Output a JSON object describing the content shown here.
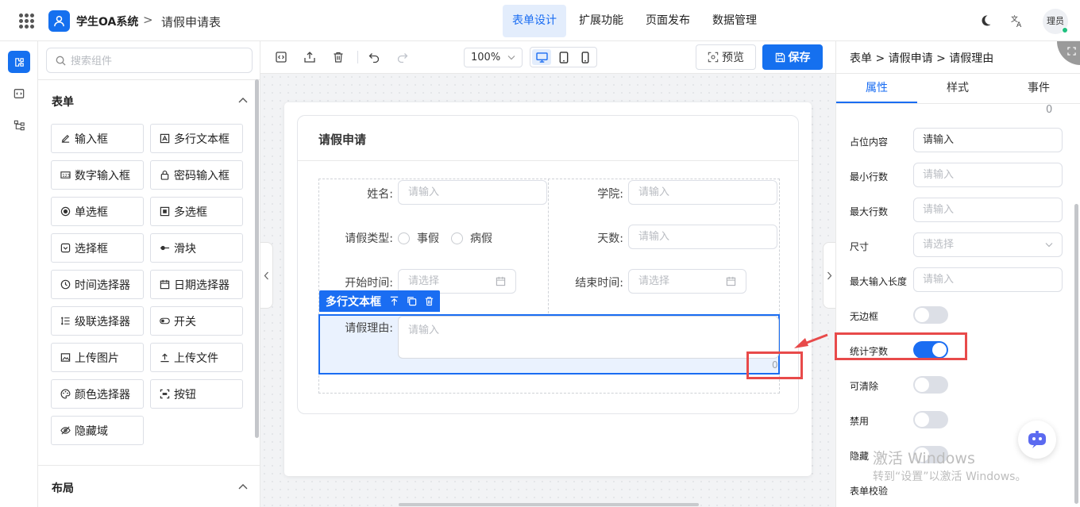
{
  "header": {
    "app_name": "学生OA系统",
    "separator": ">",
    "page_name": "请假申请表",
    "nav": [
      "表单设计",
      "扩展功能",
      "页面发布",
      "数据管理"
    ],
    "active_nav": "表单设计",
    "avatar": "理员"
  },
  "components": {
    "search_placeholder": "搜索组件",
    "group_form": "表单",
    "items": [
      {
        "label": "输入框",
        "icon": "edit-icon"
      },
      {
        "label": "多行文本框",
        "icon": "textarea-icon"
      },
      {
        "label": "数字输入框",
        "icon": "number-icon"
      },
      {
        "label": "密码输入框",
        "icon": "lock-icon"
      },
      {
        "label": "单选框",
        "icon": "radio-icon"
      },
      {
        "label": "多选框",
        "icon": "checkbox-icon"
      },
      {
        "label": "选择框",
        "icon": "select-icon"
      },
      {
        "label": "滑块",
        "icon": "slider-icon"
      },
      {
        "label": "时间选择器",
        "icon": "clock-icon"
      },
      {
        "label": "日期选择器",
        "icon": "calendar-icon"
      },
      {
        "label": "级联选择器",
        "icon": "cascader-icon"
      },
      {
        "label": "开关",
        "icon": "switch-icon"
      },
      {
        "label": "上传图片",
        "icon": "image-icon"
      },
      {
        "label": "上传文件",
        "icon": "upload-icon"
      },
      {
        "label": "颜色选择器",
        "icon": "palette-icon"
      },
      {
        "label": "按钮",
        "icon": "button-icon"
      },
      {
        "label": "隐藏域",
        "icon": "eye-off-icon"
      }
    ],
    "group_layout": "布局"
  },
  "toolbar": {
    "zoom": "100%",
    "preview_label": "预览",
    "save_label": "保存"
  },
  "form": {
    "title": "请假申请",
    "fields": {
      "name_label": "姓名:",
      "name_placeholder": "请输入",
      "college_label": "学院:",
      "college_placeholder": "请输入",
      "leave_type_label": "请假类型:",
      "leave_options": [
        "事假",
        "病假"
      ],
      "days_label": "天数:",
      "days_placeholder": "请输入",
      "start_label": "开始时间:",
      "start_placeholder": "请选择",
      "end_label": "结束时间:",
      "end_placeholder": "请选择",
      "reason_label": "请假理由:",
      "reason_placeholder": "请输入",
      "reason_count": "0"
    },
    "selected_tag": "多行文本框"
  },
  "props": {
    "breadcrumb": [
      "表单",
      "请假申请",
      "请假理由"
    ],
    "tabs": [
      "属性",
      "样式",
      "事件"
    ],
    "active_tab": "属性",
    "top_count": "0",
    "rows": {
      "placeholder_label": "占位内容",
      "placeholder_value": "请输入",
      "min_rows_label": "最小行数",
      "min_rows_placeholder": "请输入",
      "max_rows_label": "最大行数",
      "max_rows_placeholder": "请输入",
      "size_label": "尺寸",
      "size_placeholder": "请选择",
      "max_len_label": "最大输入长度",
      "max_len_placeholder": "请输入",
      "no_border_label": "无边框",
      "show_count_label": "统计字数",
      "clearable_label": "可清除",
      "disabled_label": "禁用",
      "hidden_label": "隐藏",
      "validation_label": "表单校验"
    },
    "toggles": {
      "no_border": false,
      "show_count": true,
      "clearable": false,
      "disabled": false,
      "hidden": false
    }
  },
  "watermark": {
    "line1": "激活 Windows",
    "line2": "转到“设置”以激活 Windows。"
  },
  "colors": {
    "primary": "#1570ef",
    "highlight_red": "#e84a4a"
  }
}
